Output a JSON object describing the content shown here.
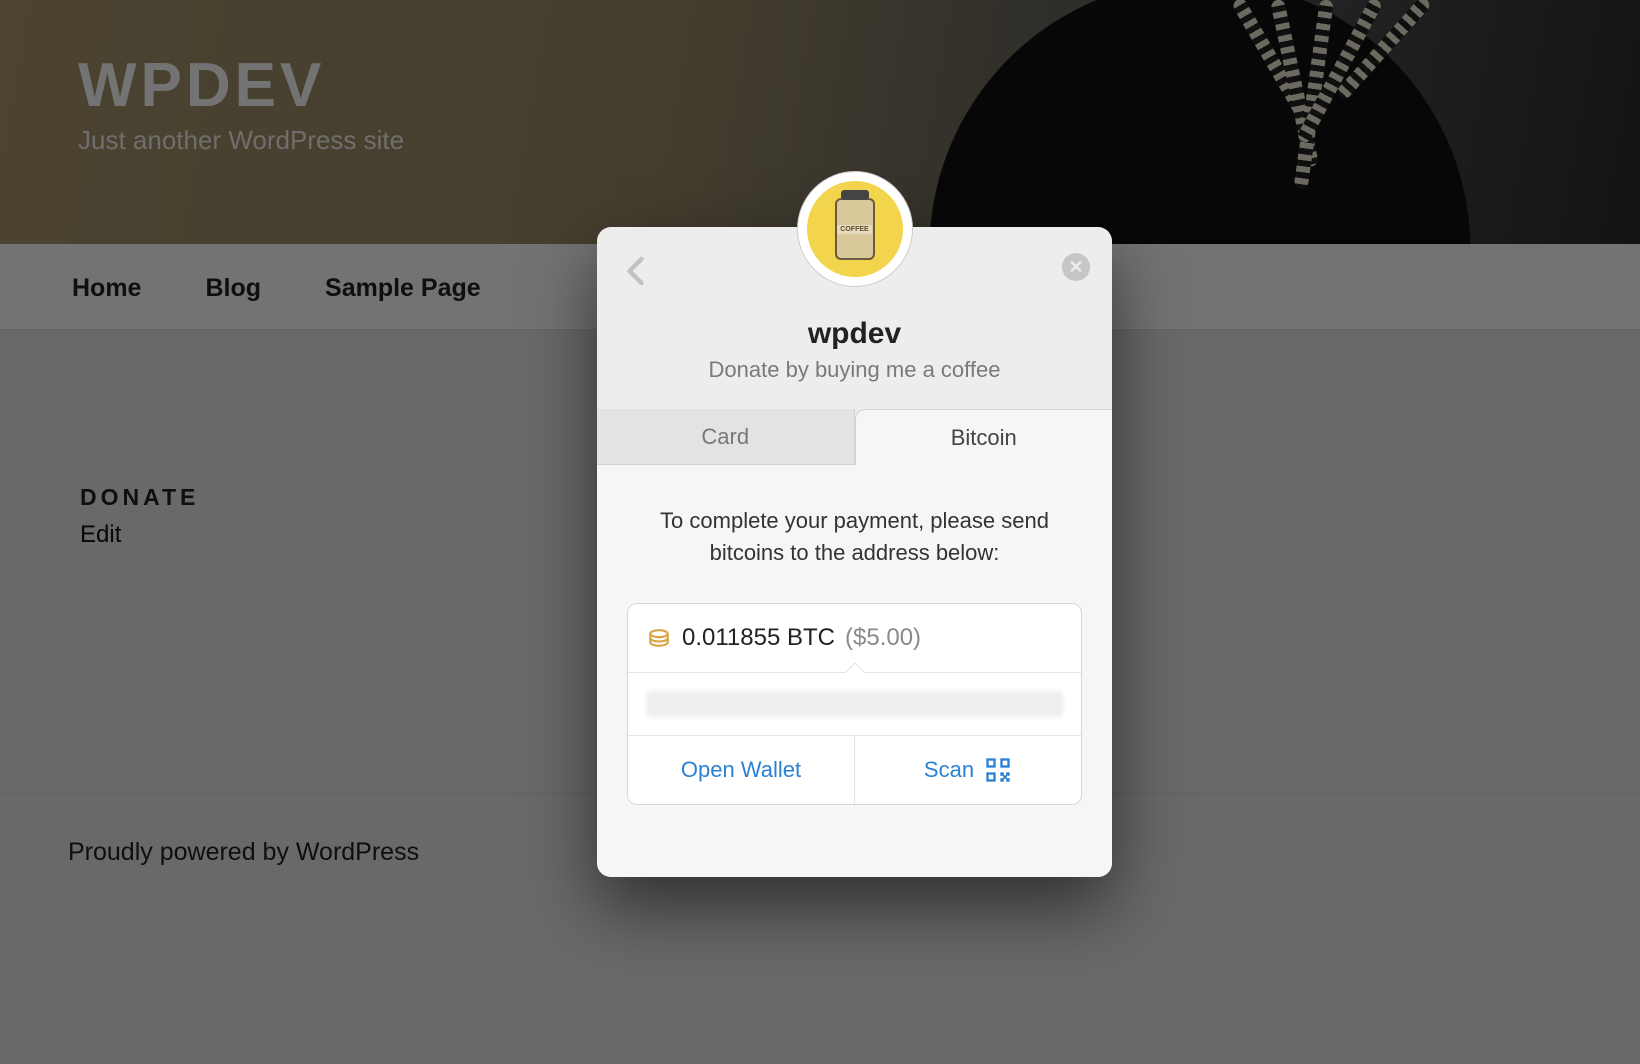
{
  "site": {
    "title": "WPDEV",
    "tagline": "Just another WordPress site"
  },
  "nav": {
    "items": [
      "Home",
      "Blog",
      "Sample Page"
    ]
  },
  "content": {
    "heading": "DONATE",
    "edit": "Edit"
  },
  "footer": {
    "text": "Proudly powered by WordPress"
  },
  "modal": {
    "avatar_label": "COFFEE",
    "title": "wpdev",
    "subtitle": "Donate by buying me a coffee",
    "tabs": {
      "card": "Card",
      "bitcoin": "Bitcoin"
    },
    "instruction": "To complete your payment, please send bitcoins to the address below:",
    "amount_btc": "0.011855 BTC",
    "amount_usd": "($5.00)",
    "open_wallet": "Open Wallet",
    "scan": "Scan"
  }
}
